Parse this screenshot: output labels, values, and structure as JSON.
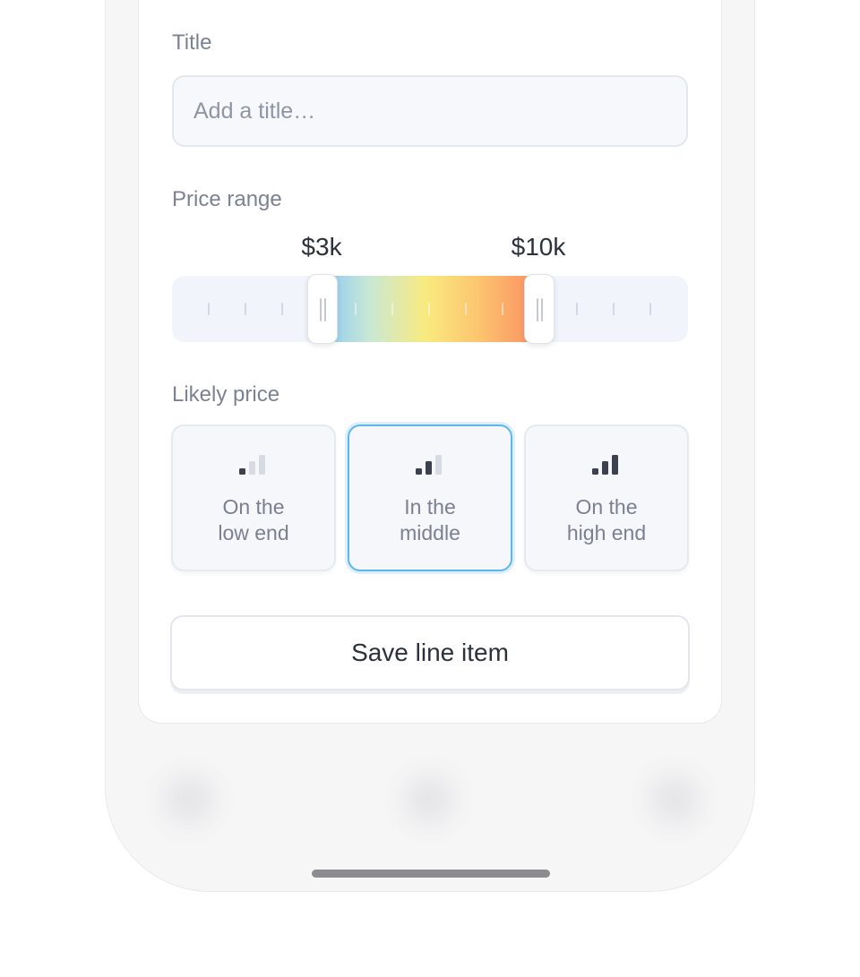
{
  "form": {
    "title_label": "Title",
    "title_placeholder": "Add a title…",
    "title_value": "",
    "price_range_label": "Price range",
    "price_min_label": "$3k",
    "price_max_label": "$10k",
    "likely_price_label": "Likely price",
    "likely_price_options": [
      {
        "label": "On the\nlow end",
        "level": 1,
        "selected": false
      },
      {
        "label": "In the\nmiddle",
        "level": 2,
        "selected": true
      },
      {
        "label": "On the\nhigh end",
        "level": 3,
        "selected": false
      }
    ],
    "save_label": "Save line item"
  },
  "colors": {
    "accent": "#5eb6ec",
    "gradient": [
      "#8cc8f5",
      "#f9ea7f",
      "#fb8e62"
    ],
    "text_muted": "#7c8293",
    "text_strong": "#2c313d"
  },
  "icons": {
    "option_icon": "signal-bars-icon",
    "handle_icon": "grip-icon"
  }
}
